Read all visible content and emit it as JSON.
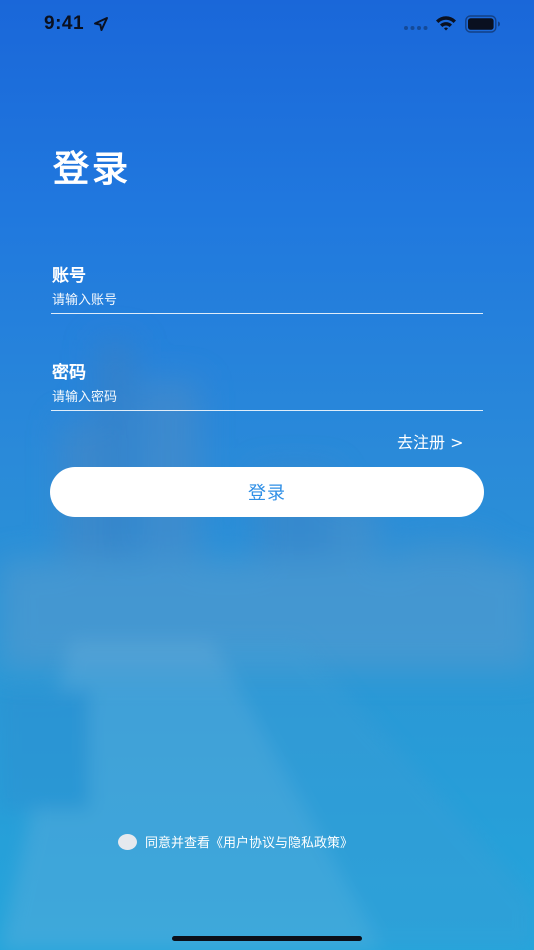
{
  "status_bar": {
    "time": "9:41",
    "icons": [
      "location-arrow-icon",
      "signal-icon",
      "wifi-icon",
      "battery-icon"
    ]
  },
  "login": {
    "title": "登录",
    "account": {
      "label": "账号",
      "placeholder": "请输入账号",
      "value": ""
    },
    "password": {
      "label": "密码",
      "placeholder": "请输入密码",
      "value": ""
    },
    "register_link": "去注册 >",
    "submit_label": "登录"
  },
  "agreement": {
    "checked": false,
    "text": "同意并查看《用户协议与隐私政策》"
  },
  "colors": {
    "background_top": "#1a67d9",
    "background_bottom": "#24a5db",
    "button_text": "#2f8fe6",
    "button_bg": "#ffffff"
  }
}
